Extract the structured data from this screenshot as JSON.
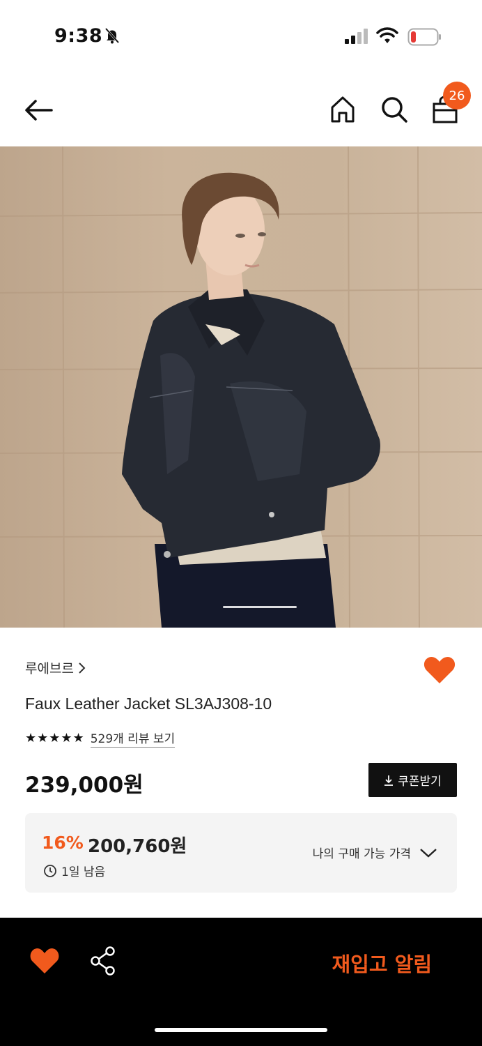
{
  "status_bar": {
    "time": "9:38"
  },
  "header": {
    "cart_count": "26"
  },
  "product": {
    "brand": "루에브르",
    "name": "Faux Leather Jacket SL3AJ308-10",
    "stars": "★★★★★",
    "review_link": "529개 리뷰 보기",
    "price": "239,000원",
    "coupon_label": "쿠폰받기"
  },
  "price_box": {
    "discount": "16%",
    "sale_price": "200,760원",
    "time_left": "1일 남음",
    "my_price_label": "나의 구매 가능 가격"
  },
  "bottom_bar": {
    "restock_label": "재입고 알림"
  },
  "colors": {
    "accent": "#f15a1d",
    "dark": "#111111",
    "box_bg": "#f4f4f4"
  },
  "icons": [
    "back-arrow-icon",
    "home-icon",
    "search-icon",
    "shopping-bag-icon",
    "heart-icon",
    "share-icon",
    "download-icon",
    "clock-icon",
    "chevron-down-icon",
    "chevron-right-icon"
  ]
}
